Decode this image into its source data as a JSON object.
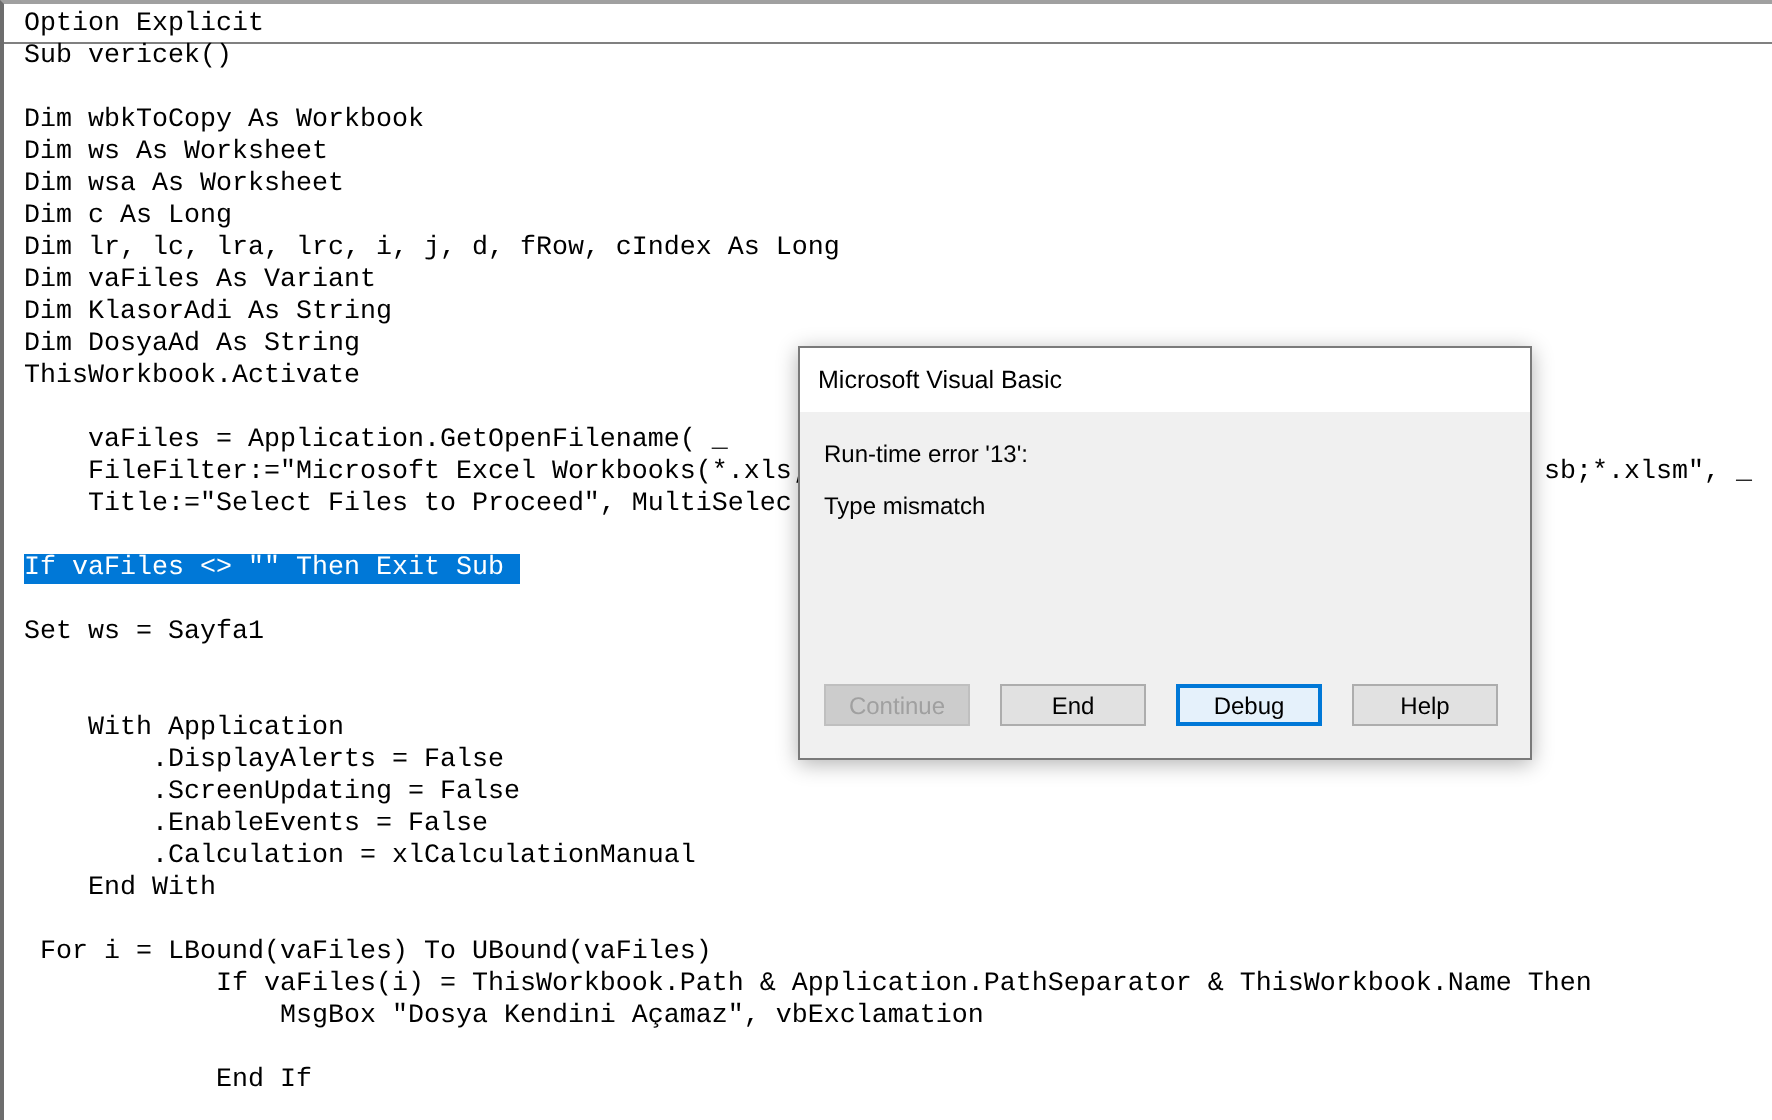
{
  "code_lines": [
    {
      "kind": "code",
      "text": "Option Explicit",
      "selected": false
    },
    {
      "kind": "divider"
    },
    {
      "kind": "code",
      "text": "Sub vericek()",
      "selected": false
    },
    {
      "kind": "blank"
    },
    {
      "kind": "code",
      "text": "Dim wbkToCopy As Workbook",
      "selected": false
    },
    {
      "kind": "code",
      "text": "Dim ws As Worksheet",
      "selected": false
    },
    {
      "kind": "code",
      "text": "Dim wsa As Worksheet",
      "selected": false
    },
    {
      "kind": "code",
      "text": "Dim c As Long",
      "selected": false
    },
    {
      "kind": "code",
      "text": "Dim lr, lc, lra, lrc, i, j, d, fRow, cIndex As Long",
      "selected": false
    },
    {
      "kind": "code",
      "text": "Dim vaFiles As Variant",
      "selected": false
    },
    {
      "kind": "code",
      "text": "Dim KlasorAdi As String",
      "selected": false
    },
    {
      "kind": "code",
      "text": "Dim DosyaAd As String",
      "selected": false
    },
    {
      "kind": "code",
      "text": "ThisWorkbook.Activate",
      "selected": false
    },
    {
      "kind": "blank"
    },
    {
      "kind": "code",
      "text": "    vaFiles = Application.GetOpenFilename( _",
      "selected": false
    },
    {
      "kind": "code",
      "text": "    FileFilter:=\"Microsoft Excel Workbooks(*.xls;",
      "tail": "sb;*.xlsm\", _",
      "selected": false
    },
    {
      "kind": "code",
      "text": "    Title:=\"Select Files to Proceed\", MultiSelec",
      "selected": false
    },
    {
      "kind": "blank"
    },
    {
      "kind": "code",
      "text": "If vaFiles <> \"\" Then Exit Sub ",
      "selected": true
    },
    {
      "kind": "blank"
    },
    {
      "kind": "code",
      "text": "Set ws = Sayfa1",
      "selected": false
    },
    {
      "kind": "blank"
    },
    {
      "kind": "blank"
    },
    {
      "kind": "code",
      "text": "    With Application",
      "selected": false
    },
    {
      "kind": "code",
      "text": "        .DisplayAlerts = False",
      "selected": false
    },
    {
      "kind": "code",
      "text": "        .ScreenUpdating = False",
      "selected": false
    },
    {
      "kind": "code",
      "text": "        .EnableEvents = False",
      "selected": false
    },
    {
      "kind": "code",
      "text": "        .Calculation = xlCalculationManual",
      "selected": false
    },
    {
      "kind": "code",
      "text": "    End With",
      "selected": false
    },
    {
      "kind": "blank"
    },
    {
      "kind": "code",
      "text": " For i = LBound(vaFiles) To UBound(vaFiles)",
      "selected": false
    },
    {
      "kind": "code",
      "text": "            If vaFiles(i) = ThisWorkbook.Path & Application.PathSeparator & ThisWorkbook.Name Then",
      "selected": false
    },
    {
      "kind": "code",
      "text": "                MsgBox \"Dosya Kendini Açamaz\", vbExclamation",
      "selected": false
    },
    {
      "kind": "blank"
    },
    {
      "kind": "code",
      "text": "            End If",
      "selected": false
    }
  ],
  "dialog": {
    "title": "Microsoft Visual Basic",
    "error": "Run-time error '13':",
    "message": "Type mismatch",
    "buttons": [
      {
        "label": "Continue",
        "disabled": true,
        "focused": false
      },
      {
        "label": "End",
        "disabled": false,
        "focused": false
      },
      {
        "label": "Debug",
        "disabled": false,
        "focused": true
      },
      {
        "label": "Help",
        "disabled": false,
        "focused": false
      }
    ]
  }
}
